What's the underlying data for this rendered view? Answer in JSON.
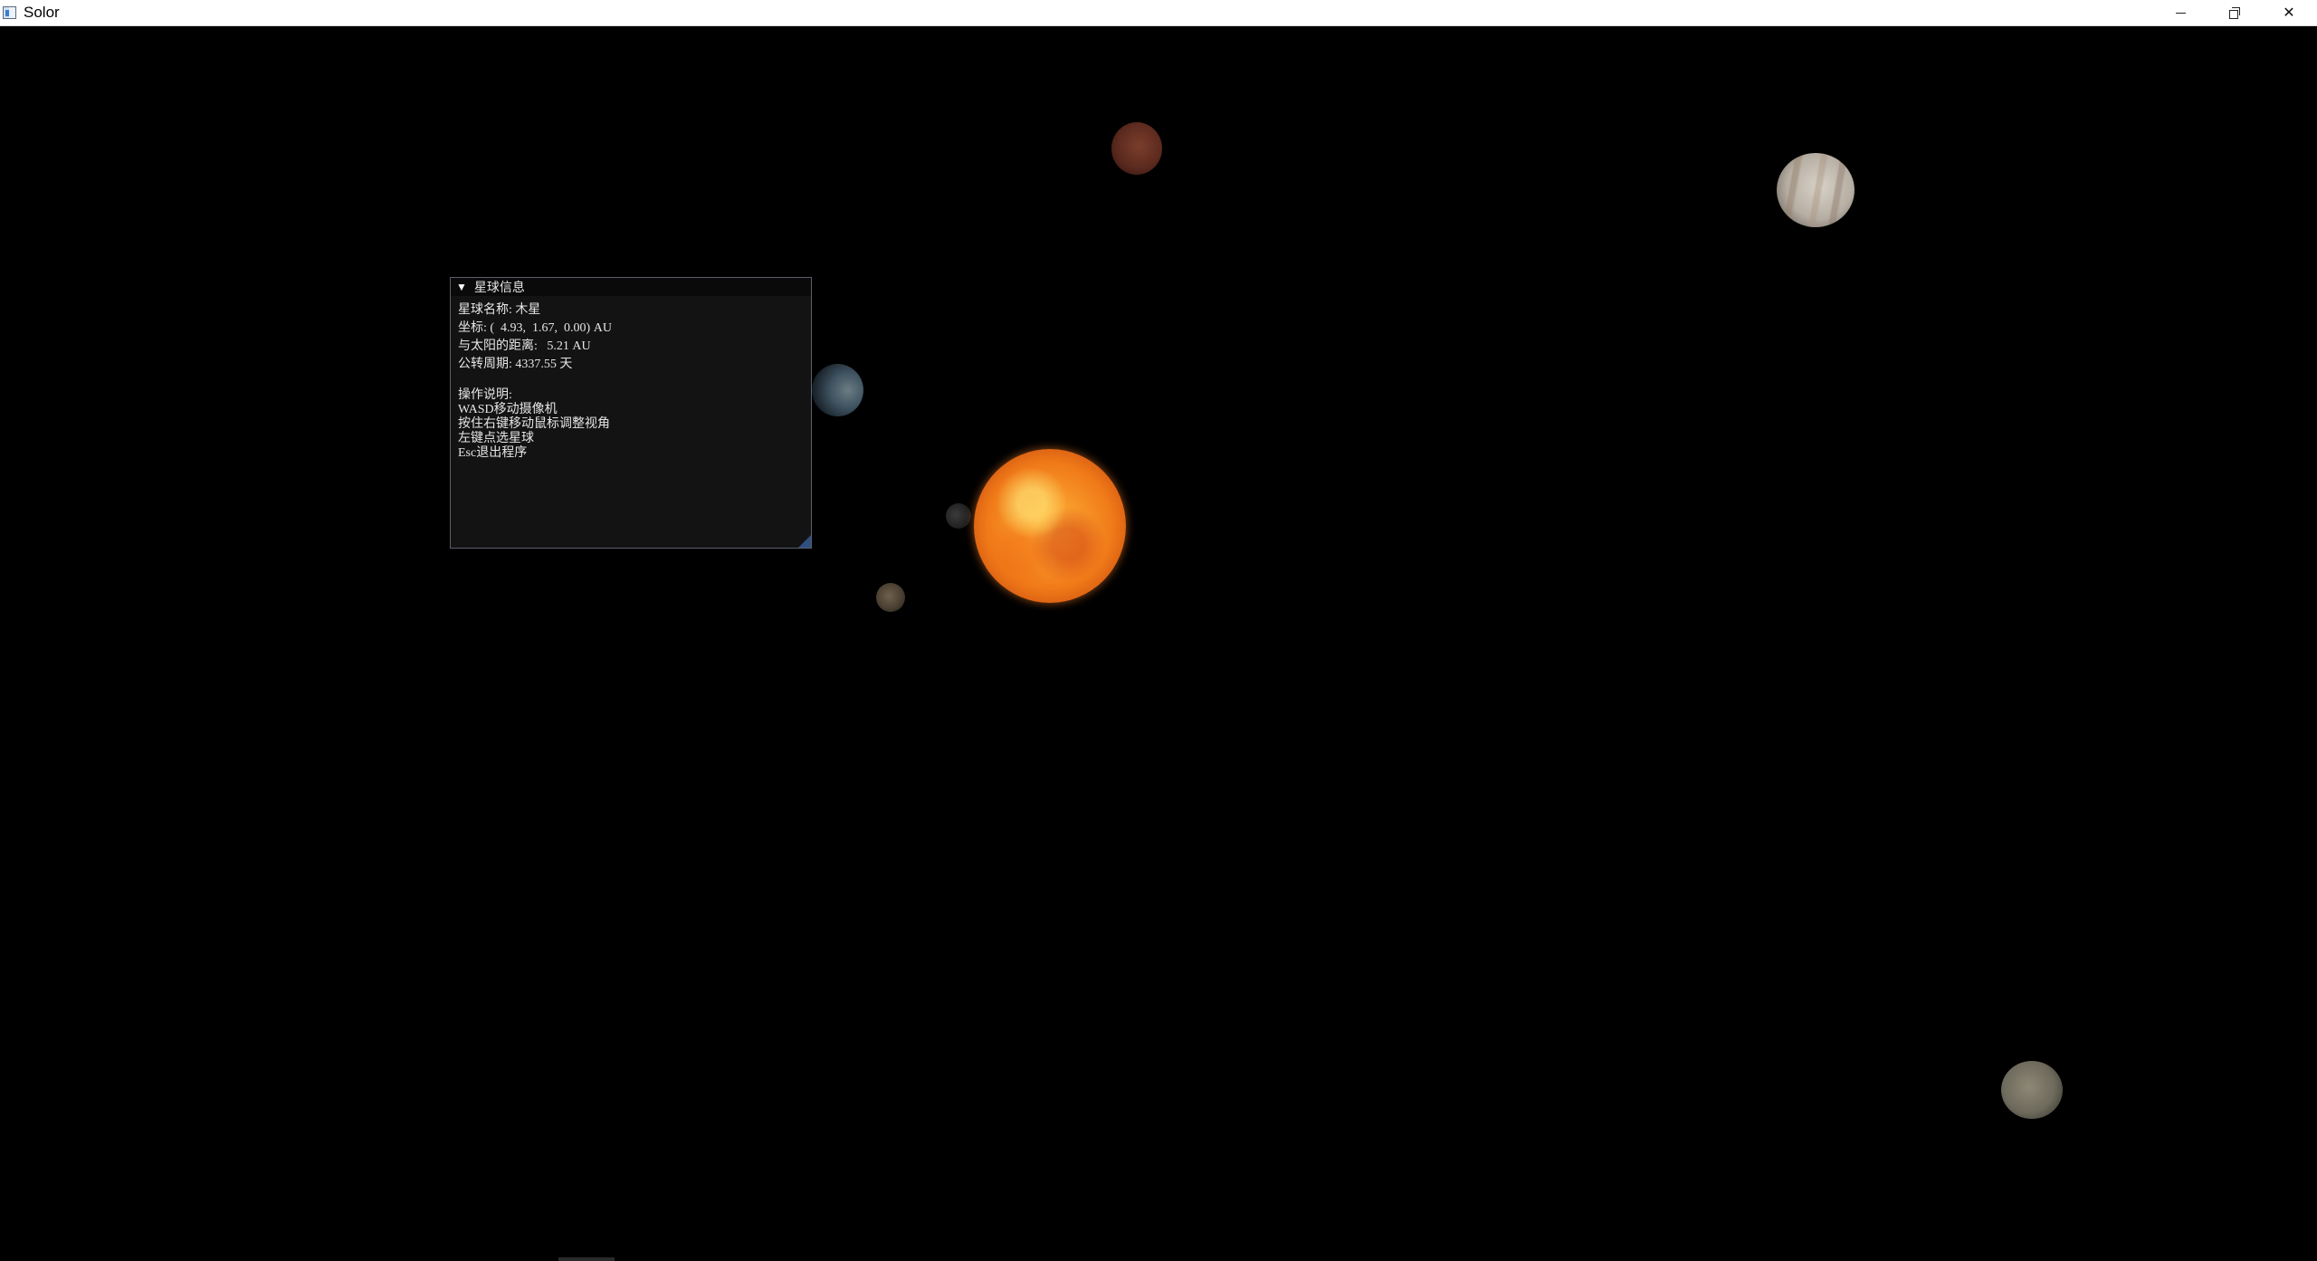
{
  "window": {
    "title": "Solor",
    "minimize_icon": "minimize-icon",
    "restore_icon": "restore-icon",
    "close_icon": "close-icon",
    "close_glyph": "✕"
  },
  "info_panel": {
    "header_arrow": "▼",
    "header_title": "星球信息",
    "planet_name": "星球名称: 木星",
    "coordinates": "坐标: (  4.93,  1.67,  0.00) AU",
    "distance": "与太阳的距离:   5.21 AU",
    "period": "公转周期: 4337.55 天",
    "help_title": "操作说明:",
    "help_lines": [
      "WASD移动摄像机",
      "按住右键移动鼠标调整视角",
      "左键点选星球",
      "Esc退出程序"
    ]
  },
  "scene": {
    "background": "#000000",
    "bodies": [
      "sun",
      "mercury",
      "venus",
      "earth",
      "mars",
      "jupiter",
      "saturn"
    ]
  }
}
